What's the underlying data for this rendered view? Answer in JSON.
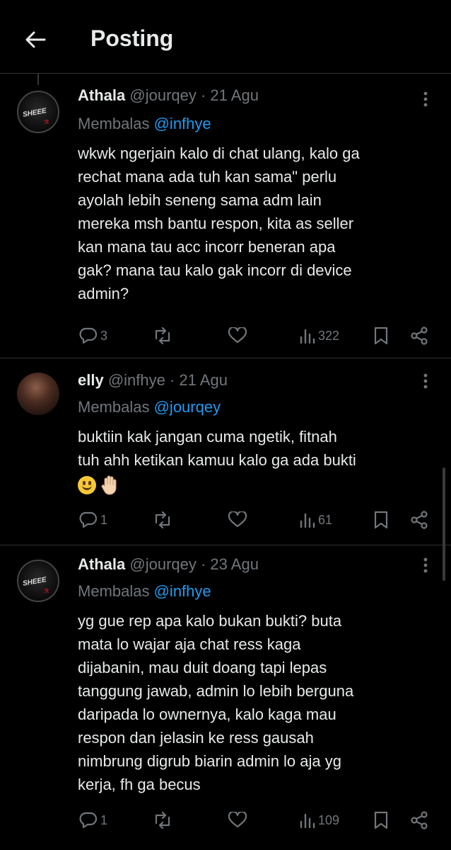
{
  "header": {
    "title": "Posting"
  },
  "tweets": [
    {
      "name": "Athala",
      "handle": "@jourqey · 21 Agu",
      "reply_prefix": "Membalas ",
      "reply_mention": "@infhye",
      "text": "wkwk ngerjain kalo di chat ulang, kalo ga\nrechat mana ada tuh kan sama\" perlu\nayolah lebih seneng sama adm lain\nmereka msh bantu respon, kita as seller\nkan mana tau acc incorr beneran apa\ngak? mana tau kalo gak incorr di device\nadmin?",
      "replies": "3",
      "retweets": "",
      "likes": "",
      "views": "322"
    },
    {
      "name": "elly",
      "handle": "@infhye · 21 Agu",
      "reply_prefix": "Membalas ",
      "reply_mention": "@jourqey",
      "text": "buktiin kak jangan cuma ngetik, fitnah\ntuh ahh ketikan kamuu kalo ga ada bukti",
      "emojis": [
        "grinning-face",
        "raised-hand"
      ],
      "replies": "1",
      "retweets": "",
      "likes": "",
      "views": "61"
    },
    {
      "name": "Athala",
      "handle": "@jourqey · 23 Agu",
      "reply_prefix": "Membalas ",
      "reply_mention": "@infhye",
      "text": "yg gue rep apa kalo bukan bukti? buta\nmata lo wajar aja chat ress kaga\ndijabanin, mau duit doang tapi lepas\ntanggung jawab, admin lo lebih berguna\ndaripada lo ownernya, kalo kaga mau\nrespon dan jelasin ke ress gausah\nnimbrung digrub biarin admin lo aja yg\nkerja, fh ga becus",
      "replies": "1",
      "retweets": "",
      "likes": "",
      "views": "109"
    }
  ],
  "avatar_athala": {
    "text": "SHEEE",
    "red_text": "ℛ"
  },
  "colors": {
    "background": "#000000",
    "text": "#e7e9ea",
    "muted": "#71767b",
    "link": "#1d9bf0",
    "divider": "#2f3336"
  }
}
